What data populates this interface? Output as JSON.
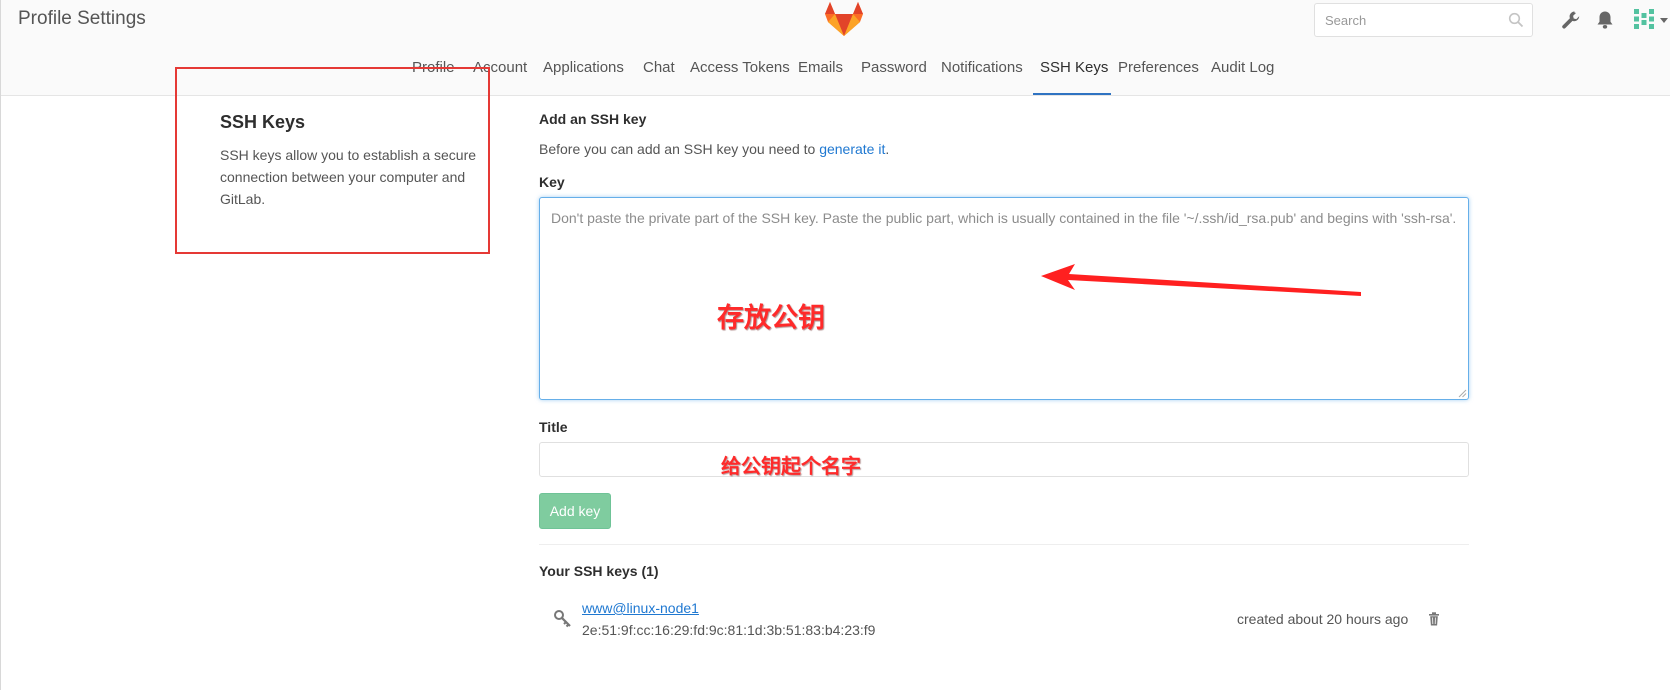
{
  "header": {
    "title": "Profile Settings",
    "logo_icon": "gitlab-tanuki-icon",
    "search": {
      "placeholder": "Search",
      "value": ""
    },
    "icons": [
      "wrench-icon",
      "bell-icon",
      "avatar",
      "chevron-down-icon"
    ]
  },
  "tabs": [
    {
      "label": "Profile",
      "active": false
    },
    {
      "label": "Account",
      "active": false
    },
    {
      "label": "Applications",
      "active": false
    },
    {
      "label": "Chat",
      "active": false
    },
    {
      "label": "Access Tokens",
      "active": false
    },
    {
      "label": "Emails",
      "active": false
    },
    {
      "label": "Password",
      "active": false
    },
    {
      "label": "Notifications",
      "active": false
    },
    {
      "label": "SSH Keys",
      "active": true
    },
    {
      "label": "Preferences",
      "active": false
    },
    {
      "label": "Audit Log",
      "active": false
    }
  ],
  "sidebar": {
    "title": "SSH Keys",
    "description": "SSH keys allow you to establish a secure connection between your computer and GitLab."
  },
  "form": {
    "heading": "Add an SSH key",
    "help_prefix": "Before you can add an SSH key you need to ",
    "help_link": "generate it",
    "help_suffix": ".",
    "key_label": "Key",
    "key_placeholder": "Don't paste the private part of the SSH key. Paste the public part, which is usually contained in the file '~/.ssh/id_rsa.pub' and begins with 'ssh-rsa'.",
    "key_value": "",
    "title_label": "Title",
    "title_value": "",
    "submit_label": "Add key"
  },
  "keys": {
    "heading": "Your SSH keys (1)",
    "items": [
      {
        "name": "www@linux-node1",
        "fingerprint": "2e:51:9f:cc:16:29:fd:9c:81:1d:3b:51:83:b4:23:f9",
        "created": "created about 20 hours ago"
      }
    ]
  },
  "annotations": {
    "key_note": "存放公钥",
    "title_note": "给公钥起个名字"
  },
  "colors": {
    "link": "#1f78d1",
    "active_tab_underline": "#2f73c2",
    "add_button": "#7fcc9f",
    "annotation_red": "#ff2a2a"
  }
}
